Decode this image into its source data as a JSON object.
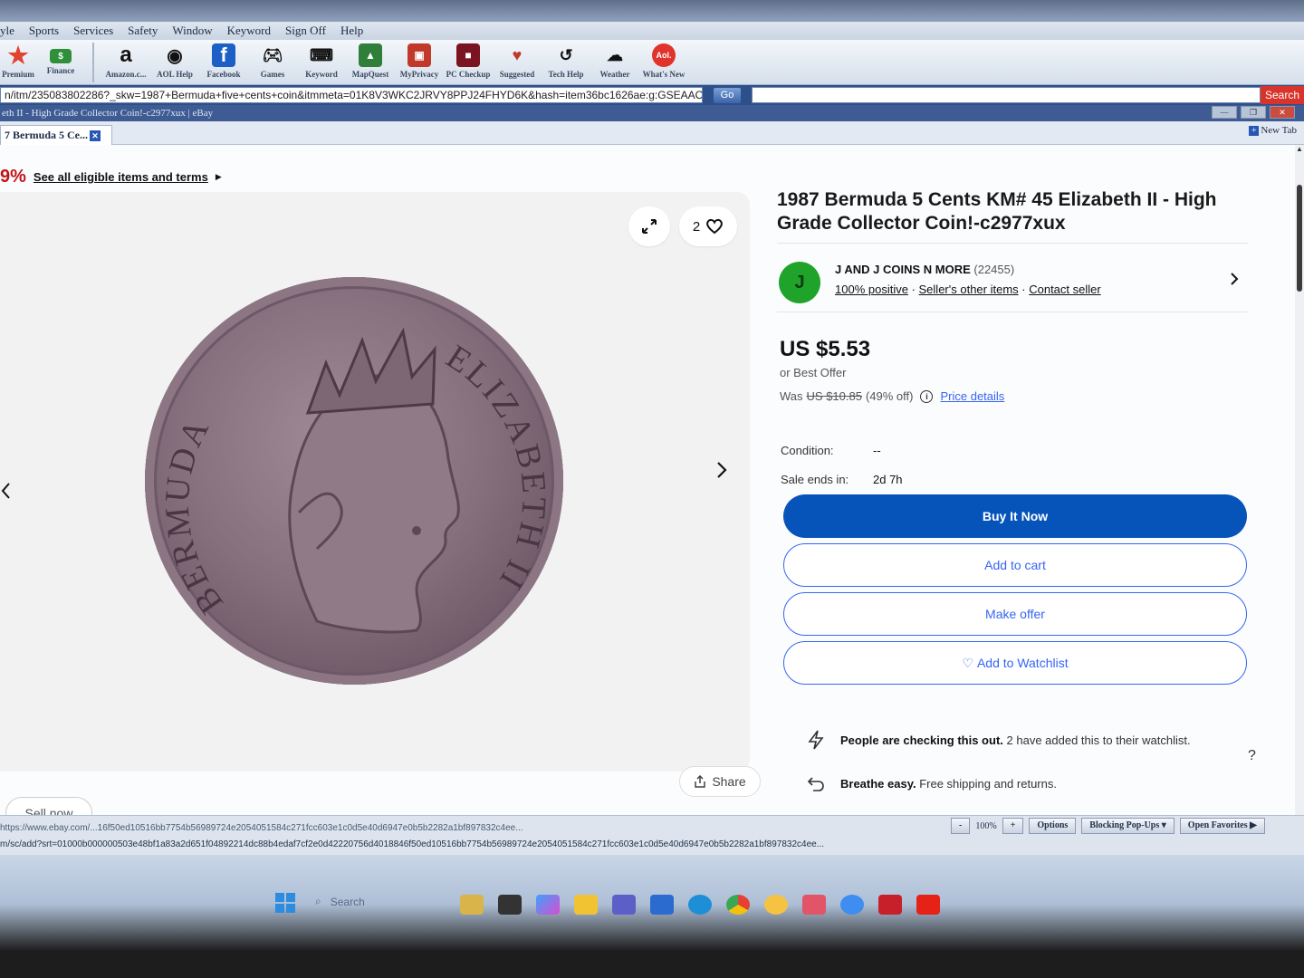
{
  "browser": {
    "menu": [
      "yle",
      "Sports",
      "Services",
      "Safety",
      "Window",
      "Keyword",
      "Sign Off",
      "Help"
    ],
    "toolbar_left": [
      {
        "label": "Premium",
        "icon": "star-icon",
        "color": "#e2432f"
      },
      {
        "label": "Finance",
        "icon": "money-icon",
        "color": "#2f8f3a"
      }
    ],
    "toolbar": [
      {
        "label": "Amazon.c...",
        "icon": "amazon-icon",
        "color": "#ffffff"
      },
      {
        "label": "AOL Help",
        "icon": "aol-help-icon",
        "color": "#ffffff"
      },
      {
        "label": "Facebook",
        "icon": "facebook-icon",
        "color": "#1b5fc7"
      },
      {
        "label": "Games",
        "icon": "gamepad-icon",
        "color": "#ffffff"
      },
      {
        "label": "Keyword",
        "icon": "keyword-icon",
        "color": "#ffffff"
      },
      {
        "label": "MapQuest",
        "icon": "mapquest-icon",
        "color": "#2f7f3a"
      },
      {
        "label": "MyPrivacy",
        "icon": "privacy-icon",
        "color": "#c0392b"
      },
      {
        "label": "PC Checkup",
        "icon": "pc-checkup-icon",
        "color": "#b7202a"
      },
      {
        "label": "Suggested",
        "icon": "suggested-icon",
        "color": "#ffffff"
      },
      {
        "label": "Tech Help",
        "icon": "tech-help-icon",
        "color": "#ffffff"
      },
      {
        "label": "Weather",
        "icon": "weather-icon",
        "color": "#ffffff"
      },
      {
        "label": "What's New",
        "icon": "aol-logo-icon",
        "color": "#e0332c"
      }
    ],
    "url": "n/itm/235083802286?_skw=1987+Bermuda+five+cents+coin&itmmeta=01K8V3WKC2JRVY8PPJ24FHYD6K&hash=item36bc1626ae:g:GSEAAO",
    "go_label": "Go",
    "search_label": "Search",
    "window_title": "eth II - High Grade Collector Coin!-c2977xux | eBay",
    "tab_label": "7 Bermuda 5 Ce...",
    "new_tab_label": "New Tab"
  },
  "page": {
    "promo_pct": "9%",
    "promo_link": "See all eligible items and terms",
    "gallery": {
      "watch_count": "2",
      "coin_inscription_left": "BERMUDA",
      "coin_inscription_right": "ELIZABETH II"
    },
    "share_label": "Share",
    "sell_label": "Sell now",
    "title": "1987 Bermuda 5 Cents KM# 45 Elizabeth II - High Grade Collector Coin!-c2977xux",
    "seller": {
      "initial": "J",
      "name": "J AND J COINS N MORE",
      "count": "(22455)",
      "positive": "100% positive",
      "other_items": "Seller's other items",
      "contact": "Contact seller"
    },
    "price": "US $5.53",
    "best_offer": "or Best Offer",
    "was_prefix": "Was",
    "was_price": "US $10.85",
    "was_discount": "(49% off)",
    "price_details": "Price details",
    "condition_label": "Condition:",
    "condition_value": "--",
    "sale_ends_label": "Sale ends in:",
    "sale_ends_value": "2d 7h",
    "buttons": {
      "buy": "Buy It Now",
      "cart": "Add to cart",
      "offer": "Make offer",
      "watch": "Add to Watchlist"
    },
    "info1_bold": "People are checking this out.",
    "info1_text": "2 have added this to their watchlist.",
    "info2_bold": "Breathe easy.",
    "info2_text": "Free shipping and returns.",
    "help_mark": "?"
  },
  "statusbar": {
    "hover_url": "https://www.ebay.com/...16f50ed10516bb7754b56989724e2054051584c271fcc603e1c0d5e40d6947e0b5b2282a1bf897832c4ee...",
    "url2": "m/sc/add?srt=01000b000000503e48bf1a83a2d651f04892214dc88b4edaf7cf2e0d42220756d4018846f50ed10516bb7754b56989724e2054051584c271fcc603e1c0d5e40d6947e0b5b2282a1bf897832c4ee...",
    "zoom": "100%",
    "options": "Options",
    "popups": "Blocking Pop-Ups",
    "favorites": "Open Favorites"
  },
  "taskbar": {
    "search_placeholder": "Search"
  },
  "colors": {
    "ebay_blue": "#0654ba",
    "link_blue": "#3665f3",
    "seller_green": "#1fa32a",
    "promo_red": "#c2141b"
  }
}
